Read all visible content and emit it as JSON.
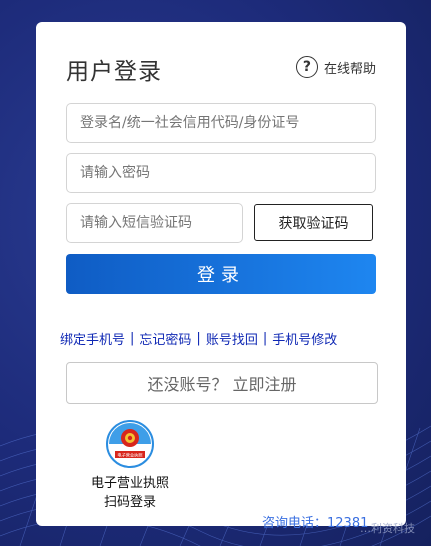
{
  "login": {
    "title": "用户登录",
    "help_label": "在线帮助",
    "help_icon": "question-circle-icon",
    "username_placeholder": "登录名/统一社会信用代码/身份证号",
    "password_placeholder": "请输入密码",
    "sms_placeholder": "请输入短信验证码",
    "get_code_label": "获取验证码",
    "login_label": "登录"
  },
  "links": {
    "items": [
      "绑定手机号",
      "忘记密码",
      "账号找回",
      "手机号修改"
    ],
    "separator": "|"
  },
  "register_label": "还没账号？ 立即注册",
  "license": {
    "emblem_text": "电子营业执照",
    "line1": "电子营业执照",
    "line2": "扫码登录"
  },
  "contact": "咨询电话：12381",
  "watermark": "…利资科技",
  "colors": {
    "accent": "#1e86f0",
    "link": "#0f28b4",
    "background": "#1c2c78"
  }
}
